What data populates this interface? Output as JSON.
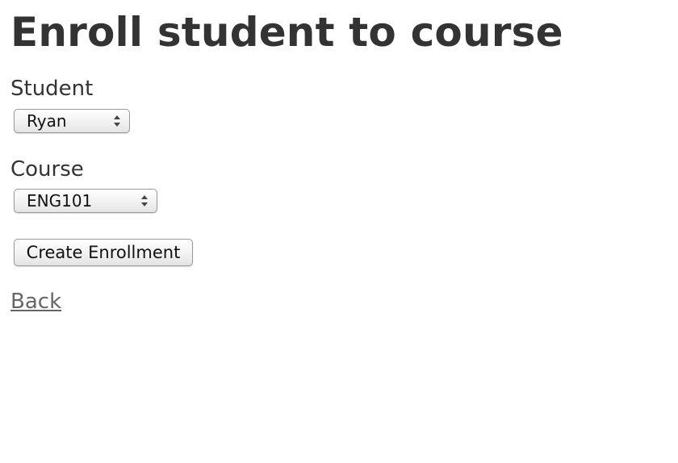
{
  "page": {
    "title": "Enroll student to course"
  },
  "form": {
    "student_label": "Student",
    "student_selected": "Ryan",
    "course_label": "Course",
    "course_selected": "ENG101",
    "submit_label": "Create Enrollment"
  },
  "navigation": {
    "back_label": "Back"
  },
  "icons": {
    "select_arrows": "up-down-chevron-icon"
  },
  "colors": {
    "text": "#333333",
    "link": "#666666",
    "control_border": "#9a9a9a"
  }
}
